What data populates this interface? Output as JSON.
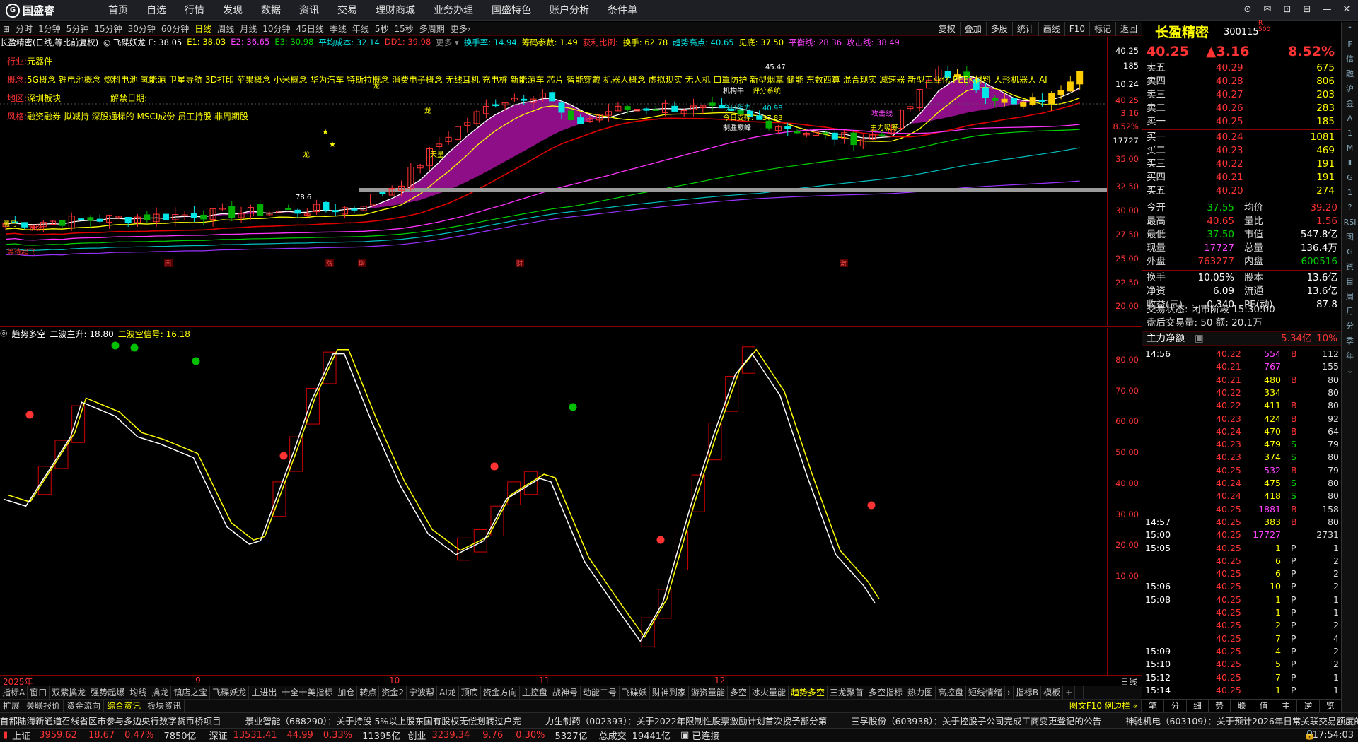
{
  "app": {
    "name": "国盛睿"
  },
  "menu": [
    "首页",
    "自选",
    "行情",
    "发现",
    "数据",
    "资讯",
    "交易",
    "理财商城",
    "业务办理",
    "国盛特色",
    "账户分析",
    "条件单"
  ],
  "window_controls": [
    "⊙",
    "✉",
    "⊡",
    "⊟",
    "—",
    "✕"
  ],
  "periods": [
    "分时",
    "1分钟",
    "5分钟",
    "15分钟",
    "30分钟",
    "60分钟",
    "日线",
    "周线",
    "月线",
    "10分钟",
    "45日线",
    "季线",
    "年线",
    "5秒",
    "15秒",
    "多周期",
    "更多›"
  ],
  "active_period": "日线",
  "toolbar_right": [
    "复权",
    "叠加",
    "多股",
    "统计",
    "画线",
    "F10",
    "标记",
    "返回"
  ],
  "legend_main": [
    {
      "t": "长盈精密(日线,等比前复权)",
      "c": "#ffffff"
    },
    {
      "t": "◎ 飞碟妖龙 E: 38.05",
      "c": "#ffffff"
    },
    {
      "t": "E1: 38.03",
      "c": "#ffff00"
    },
    {
      "t": "E2: 36.65",
      "c": "#ff44ff"
    },
    {
      "t": "E3: 30.98",
      "c": "#00d200"
    },
    {
      "t": "平均成本: 32.14",
      "c": "#00e5e5"
    },
    {
      "t": "DD1: 39.98",
      "c": "#ff3333"
    },
    {
      "t": "更多 ▾",
      "c": "#888888"
    },
    {
      "t": "换手率: 14.94",
      "c": "#00e5e5"
    },
    {
      "t": "筹码参数: 1.49",
      "c": "#ffff00"
    },
    {
      "t": "获利比例:",
      "c": "#ff3333"
    },
    {
      "t": "换手: 62.78",
      "c": "#ffff00"
    },
    {
      "t": "趋势高点: 40.65",
      "c": "#00e5e5"
    },
    {
      "t": "见底: 37.50",
      "c": "#ffff00"
    },
    {
      "t": "平衡线: 28.36",
      "c": "#ff44ff"
    },
    {
      "t": "攻击线: 38.49",
      "c": "#ff44ff"
    }
  ],
  "info": {
    "industry_label": "行业:",
    "industry": "元器件",
    "concept_label": "概念:",
    "concepts": "5G概念 锂电池概念 燃料电池 氢能源 卫星导航 3D打印 苹果概念 小米概念 华为汽车 特斯拉概念 消费电子概念 无线耳机 充电桩 新能源车 芯片 智能穿戴 机器人概念 虚拟现实 无人机 口罩防护 新型烟草 储能 东数西算 混合现实 减速器 新型工业化 PEEK材料 人形机器人 AI",
    "region_label": "地区:",
    "region": "深圳板块",
    "unban_label": "解禁日期:",
    "style_label": "风格:",
    "style": "融资融券 拟减持 深股通标的 MSCI成份 员工持股 非周期股"
  },
  "chart_labels": {
    "dragon": "龙",
    "buy": "买",
    "sell": "卖",
    "tianliang": "天量",
    "today_resist": "今日阻力:",
    "today_resist_val": "40.98",
    "today_support": "今日支撑:",
    "today_support_val": "37.83",
    "win_peak": "制胜巅峰",
    "attack": "攻击线",
    "main_buy": "主力吸筹",
    "ma_kunlun": "机构牛",
    "zero_score": "评分系统",
    "dark_horse": "黑马",
    "leading": "领涨",
    "wait": "等待起飞",
    "peak": "45.47",
    "star": "★",
    "low_mark": "78.6",
    "event_events": [
      "回",
      "涨",
      "增",
      "财",
      "激"
    ]
  },
  "price_axis": {
    "ticks": [
      "40.25",
      "185",
      "10.24",
      "40.25",
      "3.16",
      "8.52%",
      "17727",
      "35.00",
      "32.50",
      "30.00",
      "27.50",
      "25.00",
      "22.50",
      "20.00"
    ]
  },
  "legend_sub": [
    {
      "t": "趋势多空",
      "c": "#ffffff"
    },
    {
      "t": "二波主升: 18.80",
      "c": "#ffffff"
    },
    {
      "t": "二波空信号: 16.18",
      "c": "#ffff00"
    }
  ],
  "sub_axis": {
    "ticks": [
      "80.00",
      "70.00",
      "60.00",
      "50.00",
      "40.00",
      "30.00",
      "20.00",
      "10.00"
    ]
  },
  "date_axis": {
    "labels": [
      "2025年",
      "9",
      "10",
      "11",
      "12"
    ],
    "right": "日线"
  },
  "indicators": [
    "指标A",
    "窗口",
    "双紫擒龙",
    "强势起爆",
    "均线",
    "擒龙",
    "镇店之宝",
    "飞碟妖龙",
    "主进出",
    "十全十美指标",
    "加仓",
    "转点",
    "资金2",
    "宁波帮",
    "AI龙",
    "顶底",
    "资金方向",
    "主控盘",
    "战神号",
    "动能二号",
    "飞碟妖",
    "财神到家",
    "游资量能",
    "多空",
    "冰火量能",
    "趋势多空",
    "三龙聚首",
    "多空指标",
    "热力图",
    "高控盘",
    "短线情绪",
    "›",
    "指标B",
    "模板",
    "+",
    "-"
  ],
  "active_indicator": "趋势多空",
  "tabs": [
    "扩展",
    "关联报价",
    "资金流向",
    "综合资讯",
    "板块资讯"
  ],
  "active_tab": "综合资讯",
  "tab_right": "图文F10 例边栏 «",
  "news": [
    "首都陆海新通道召线省区市参与多边央行数字货币桥项目",
    "景业智能（688290）：关于持股 5%以上股东国有股权无偿划转过户完",
    "力生制药（002393）：关于2022年限制性股票激励计划首次授予部分第",
    "三孚股份（603938）：关于控股子公司完成工商变更登记的公告",
    "神驰机电（603109）：关于预计2026年日常关联交易额度的公告"
  ],
  "statusbar": {
    "sh_label": "上证",
    "sh": "3959.62",
    "sh_chg": "18.67",
    "sh_pct": "0.47%",
    "sh_vol": "7850亿",
    "sz_label": "深证",
    "sz": "13531.41",
    "sz_chg": "44.99",
    "sz_pct": "0.33%",
    "sz_vol": "11395亿",
    "cy_label": "创业",
    "cy": "3239.34",
    "cy_chg": "9.76",
    "cy_pct": "0.30%",
    "cy_vol": "5327亿",
    "total_label": "总成交",
    "total": "19441亿",
    "conn": "已连接",
    "time": "17:54:03"
  },
  "quote": {
    "name": "长盈精密",
    "code": "300115",
    "tag": "R\n500",
    "price": "40.25",
    "change": "▲3.16",
    "pct": "8.52%",
    "asks": [
      {
        "l": "卖五",
        "p": "40.29",
        "v": "675"
      },
      {
        "l": "卖四",
        "p": "40.28",
        "v": "806"
      },
      {
        "l": "卖三",
        "p": "40.27",
        "v": "203"
      },
      {
        "l": "卖二",
        "p": "40.26",
        "v": "283"
      },
      {
        "l": "卖一",
        "p": "40.25",
        "v": "185"
      }
    ],
    "bids": [
      {
        "l": "买一",
        "p": "40.24",
        "v": "1081"
      },
      {
        "l": "买二",
        "p": "40.23",
        "v": "469"
      },
      {
        "l": "买三",
        "p": "40.22",
        "v": "191"
      },
      {
        "l": "买四",
        "p": "40.21",
        "v": "191"
      },
      {
        "l": "买五",
        "p": "40.20",
        "v": "274"
      }
    ],
    "stats": [
      {
        "l1": "今开",
        "v1": "37.55",
        "c1": "green",
        "l2": "均价",
        "v2": "39.20",
        "c2": "red"
      },
      {
        "l1": "最高",
        "v1": "40.65",
        "c1": "red",
        "l2": "量比",
        "v2": "1.56",
        "c2": "red"
      },
      {
        "l1": "最低",
        "v1": "37.50",
        "c1": "green",
        "l2": "市值",
        "v2": "547.8亿",
        "c2": "white"
      },
      {
        "l1": "现量",
        "v1": "17727",
        "c1": "purple",
        "l2": "总量",
        "v2": "136.4万",
        "c2": "white"
      },
      {
        "l1": "外盘",
        "v1": "763277",
        "c1": "red",
        "l2": "内盘",
        "v2": "600516",
        "c2": "green"
      }
    ],
    "stats2": [
      {
        "l1": "换手",
        "v1": "10.05%",
        "l2": "股本",
        "v2": "13.6亿"
      },
      {
        "l1": "净资",
        "v1": "6.09",
        "l2": "流通",
        "v2": "13.6亿"
      },
      {
        "l1": "收益(三)",
        "v1": "0.340",
        "l2": "PE(动)",
        "v2": "87.8"
      }
    ],
    "trade_state": "交易状态: 闭市阶段 15:30:00",
    "after_trade": "盘后交易量: 50  额: 20.1万",
    "net_label": "主力净额",
    "net_value": "5.34亿",
    "net_pct": "10%"
  },
  "ticks": [
    {
      "t": "14:56",
      "p": "40.22",
      "v": "554",
      "vc": "purple",
      "s": "B",
      "n": "112"
    },
    {
      "t": "",
      "p": "40.21",
      "v": "767",
      "vc": "purple",
      "s": "",
      "n": "155"
    },
    {
      "t": "",
      "p": "40.21",
      "v": "480",
      "vc": "yellow",
      "s": "B",
      "n": "80"
    },
    {
      "t": "",
      "p": "40.22",
      "v": "334",
      "vc": "yellow",
      "s": "",
      "n": "80"
    },
    {
      "t": "",
      "p": "40.22",
      "v": "411",
      "vc": "yellow",
      "s": "B",
      "n": "80"
    },
    {
      "t": "",
      "p": "40.23",
      "v": "424",
      "vc": "yellow",
      "s": "B",
      "n": "92"
    },
    {
      "t": "",
      "p": "40.24",
      "v": "470",
      "vc": "yellow",
      "s": "B",
      "n": "64"
    },
    {
      "t": "",
      "p": "40.23",
      "v": "479",
      "vc": "yellow",
      "s": "S",
      "n": "79"
    },
    {
      "t": "",
      "p": "40.23",
      "v": "374",
      "vc": "yellow",
      "s": "S",
      "n": "80"
    },
    {
      "t": "",
      "p": "40.25",
      "v": "532",
      "vc": "purple",
      "s": "B",
      "n": "79"
    },
    {
      "t": "",
      "p": "40.24",
      "v": "475",
      "vc": "yellow",
      "s": "S",
      "n": "80"
    },
    {
      "t": "",
      "p": "40.24",
      "v": "418",
      "vc": "yellow",
      "s": "S",
      "n": "80"
    },
    {
      "t": "",
      "p": "40.25",
      "v": "1881",
      "vc": "purple",
      "s": "B",
      "n": "158"
    },
    {
      "t": "14:57",
      "p": "40.25",
      "v": "383",
      "vc": "yellow",
      "s": "B",
      "n": "80"
    },
    {
      "t": "15:00",
      "p": "40.25",
      "v": "17727",
      "vc": "purple",
      "s": "",
      "n": "2731"
    },
    {
      "t": "15:05",
      "p": "40.25",
      "v": "1",
      "vc": "yellow",
      "s": "P",
      "n": "1"
    },
    {
      "t": "",
      "p": "40.25",
      "v": "6",
      "vc": "yellow",
      "s": "P",
      "n": "2"
    },
    {
      "t": "",
      "p": "40.25",
      "v": "6",
      "vc": "yellow",
      "s": "P",
      "n": "2"
    },
    {
      "t": "15:06",
      "p": "40.25",
      "v": "10",
      "vc": "yellow",
      "s": "P",
      "n": "2"
    },
    {
      "t": "15:08",
      "p": "40.25",
      "v": "1",
      "vc": "yellow",
      "s": "P",
      "n": "1"
    },
    {
      "t": "",
      "p": "40.25",
      "v": "1",
      "vc": "yellow",
      "s": "P",
      "n": "1"
    },
    {
      "t": "",
      "p": "40.25",
      "v": "2",
      "vc": "yellow",
      "s": "P",
      "n": "2"
    },
    {
      "t": "",
      "p": "40.25",
      "v": "7",
      "vc": "yellow",
      "s": "P",
      "n": "4"
    },
    {
      "t": "15:09",
      "p": "40.25",
      "v": "4",
      "vc": "yellow",
      "s": "P",
      "n": "2"
    },
    {
      "t": "15:10",
      "p": "40.25",
      "v": "5",
      "vc": "yellow",
      "s": "P",
      "n": "2"
    },
    {
      "t": "15:12",
      "p": "40.25",
      "v": "7",
      "vc": "yellow",
      "s": "P",
      "n": "1"
    },
    {
      "t": "15:14",
      "p": "40.25",
      "v": "1",
      "vc": "yellow",
      "s": "P",
      "n": "1"
    }
  ],
  "rp_bottom_tabs": [
    "笔",
    "分",
    "细",
    "势",
    "联",
    "值",
    "主",
    "逆",
    "览"
  ],
  "sidebar": [
    "⌃",
    "F",
    "信",
    "融",
    "沪",
    "金",
    "A",
    "1",
    "M",
    "Ⅱ",
    "G",
    "1",
    "?",
    "RSI",
    "图",
    "G",
    "资",
    "目",
    "周",
    "月",
    "分",
    "季",
    "年",
    "⌄"
  ]
}
